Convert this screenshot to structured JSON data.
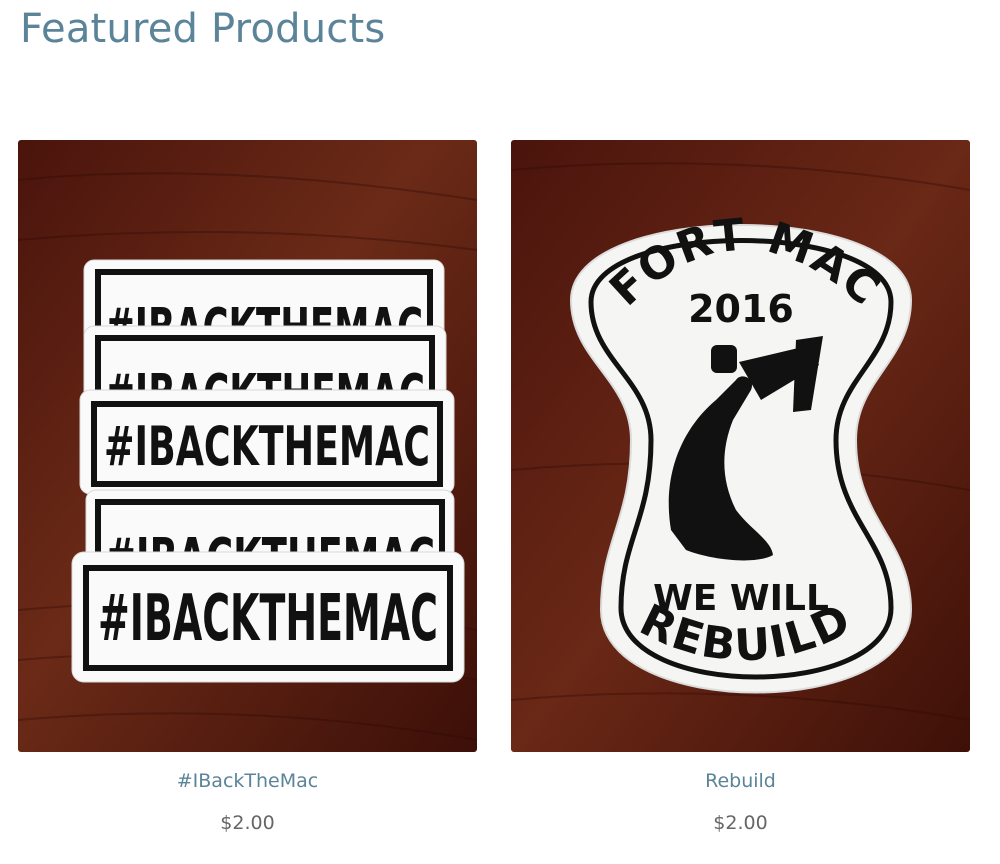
{
  "section": {
    "title": "Featured Products"
  },
  "products": [
    {
      "name": "#IBackTheMac",
      "price": "$2.00",
      "image": {
        "icon": "sticker-stack-image",
        "sticker_text": "#IBACKTHEMAC"
      }
    },
    {
      "name": "Rebuild",
      "price": "$2.00",
      "image": {
        "icon": "fort-mac-rebuild-sticker-image",
        "top_text": "FORT MAC",
        "year": "2016",
        "bottom_text_1": "WE WILL",
        "bottom_text_2": "REBUILD"
      }
    }
  ],
  "colors": {
    "title": "#5b8499",
    "link": "#5b8499",
    "price": "#666666",
    "wood": "#5a1a10"
  }
}
